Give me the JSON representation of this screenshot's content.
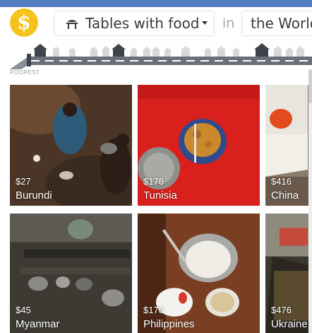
{
  "header": {
    "logo_symbol": "$",
    "topic_label": "Tables with food",
    "topic_icon": "table-icon",
    "connector": "in",
    "place_label": "the World"
  },
  "street": {
    "label_left": "POOREST"
  },
  "colors": {
    "top_bar": "#4f7dbf",
    "logo": "#f6c21c",
    "road": "#6b6f78",
    "house": "#3f444c"
  },
  "cards": [
    {
      "price": "$27",
      "country": "Burundi"
    },
    {
      "price": "$176",
      "country": "Tunisia"
    },
    {
      "price": "$416",
      "country": "China"
    },
    {
      "price": "$45",
      "country": "Myanmar"
    },
    {
      "price": "$170",
      "country": "Philippines"
    },
    {
      "price": "$476",
      "country": "Ukraine"
    }
  ]
}
